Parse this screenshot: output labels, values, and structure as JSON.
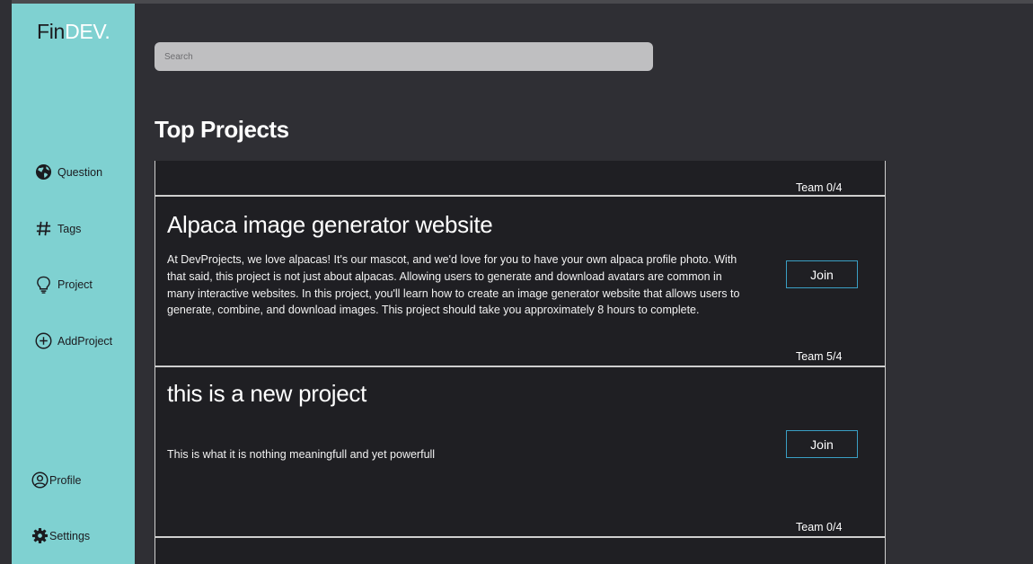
{
  "sidebar": {
    "logo_main": "Fin",
    "logo_accent": "DEV.",
    "nav": [
      {
        "label": "Question",
        "icon": "globe-icon"
      },
      {
        "label": "Tags",
        "icon": "hash-icon"
      },
      {
        "label": "Project",
        "icon": "lightbulb-icon"
      },
      {
        "label": "AddProject",
        "icon": "plus-circle-icon"
      }
    ],
    "bottom": [
      {
        "label": "Profile",
        "icon": "user-circle-icon"
      },
      {
        "label": "Settings",
        "icon": "gear-icon"
      }
    ]
  },
  "search": {
    "placeholder": "Search"
  },
  "section_title": "Top Projects",
  "projects": [
    {
      "title": "",
      "description": "",
      "team": "Team 0/4"
    },
    {
      "title": "Alpaca image generator website",
      "description": "At DevProjects, we love alpacas! It's our mascot, and we'd love for you to have your own alpaca profile photo. With that said, this project is not just about alpacas. Allowing users to generate and download avatars are common in many interactive websites. In this project, you'll learn how to create an image generator website that allows users to generate, combine, and download images. This project should take you approximately 8 hours to complete.",
      "join_label": "Join",
      "team": "Team 5/4"
    },
    {
      "title": "this is a new project",
      "description": "This is what it is nothing meaningfull and yet powerfull",
      "join_label": "Join",
      "team": "Team 0/4"
    }
  ],
  "colors": {
    "sidebar_bg": "#7fd1d1",
    "main_bg": "#2f2f34",
    "card_bg": "#1f1f23",
    "button_border": "#3a9fc4"
  }
}
